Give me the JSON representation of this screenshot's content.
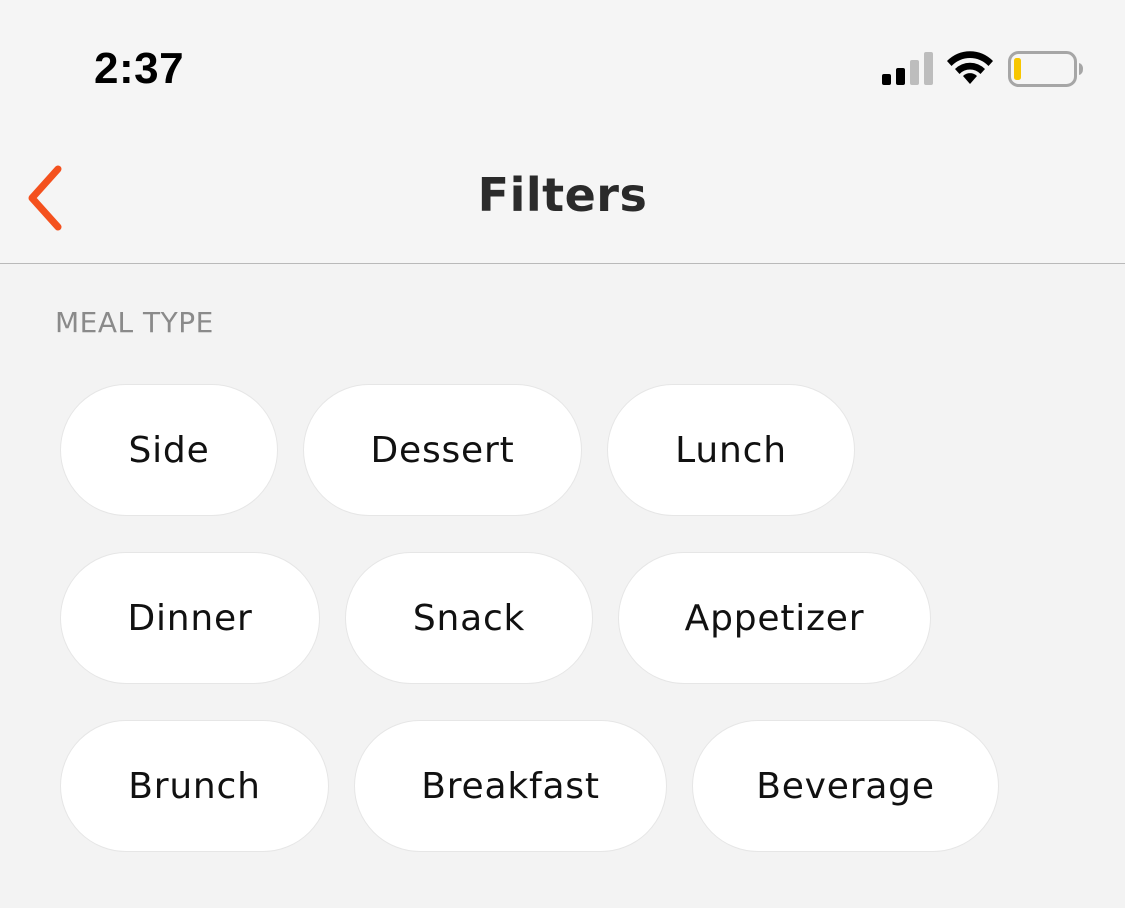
{
  "status_bar": {
    "time": "2:37",
    "signal_icon": "cellular-signal-icon",
    "wifi_icon": "wifi-icon",
    "battery_icon": "battery-low-icon",
    "battery_fill_color": "#f7c600"
  },
  "nav": {
    "back_icon": "chevron-left-icon",
    "back_color": "#f4511e",
    "title": "Filters"
  },
  "meal_type": {
    "label": "MEAL TYPE",
    "rows": [
      [
        "Side",
        "Dessert",
        "Lunch"
      ],
      [
        "Dinner",
        "Snack",
        "Appetizer"
      ],
      [
        "Brunch",
        "Breakfast",
        "Beverage"
      ]
    ]
  }
}
